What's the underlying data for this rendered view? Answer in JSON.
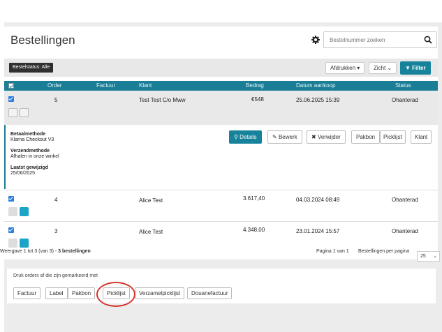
{
  "header": {
    "title": "Bestellingen",
    "search_placeholder": "Bestelnummer zoeken"
  },
  "toolbar": {
    "status_label": "Bestelstatus: Alle",
    "print_label": "Afdrukken ▾",
    "view_label": "Zicht ⌄",
    "filter_label": "Filter"
  },
  "table": {
    "columns": [
      "Order",
      "Factuur",
      "Klant",
      "Bedrag",
      "Datum aankoop",
      "Status"
    ],
    "rows": [
      {
        "order": "5",
        "factuur": "",
        "klant": "Test Test C/o Mww",
        "bedrag": "€548",
        "datum": "25.06.2025 15:39",
        "status": "Ohanterad"
      },
      {
        "order": "4",
        "factuur": "",
        "klant": "Alice Test",
        "bedrag": "3.617,40",
        "datum": "04.03.2024 08:49",
        "status": "Ohanterad"
      },
      {
        "order": "3",
        "factuur": "",
        "klant": "Alice Test",
        "bedrag": "4.348,00",
        "datum": "23.01.2024 15:57",
        "status": "Ohanterad"
      }
    ]
  },
  "expanded": {
    "payment_label": "Betaalmethode",
    "payment_value": "Klarna Checkout V3",
    "shipping_label": "Verzendmethode",
    "shipping_value": "Afhalen in onze winkel",
    "modified_label": "Laatst gewijzigd",
    "modified_value": "25/06/2025",
    "actions": {
      "details": "Details",
      "edit": "Bewerk",
      "delete": "Verwijder",
      "pakbon": "Pakbon",
      "picklijst": "Picklijst",
      "klant": "Klant"
    }
  },
  "footer": {
    "summary_prefix": "Weergave 1 tot 3 (van 3) - ",
    "summary_bold": "3 bestellingen",
    "page_info": "Pagina 1 van 1",
    "per_page_label": "Bestellingen per pagina",
    "per_page_value": "25"
  },
  "print_section": {
    "label": "Druk orders af die zijn gemarkeerd met",
    "buttons": [
      "Factuur",
      "Label",
      "Pakbon",
      "Picklijst",
      "Verzamelpicklijst",
      "Douanefactuur"
    ]
  },
  "colors": {
    "accent": "#197e96",
    "annotation": "#d9322a"
  }
}
